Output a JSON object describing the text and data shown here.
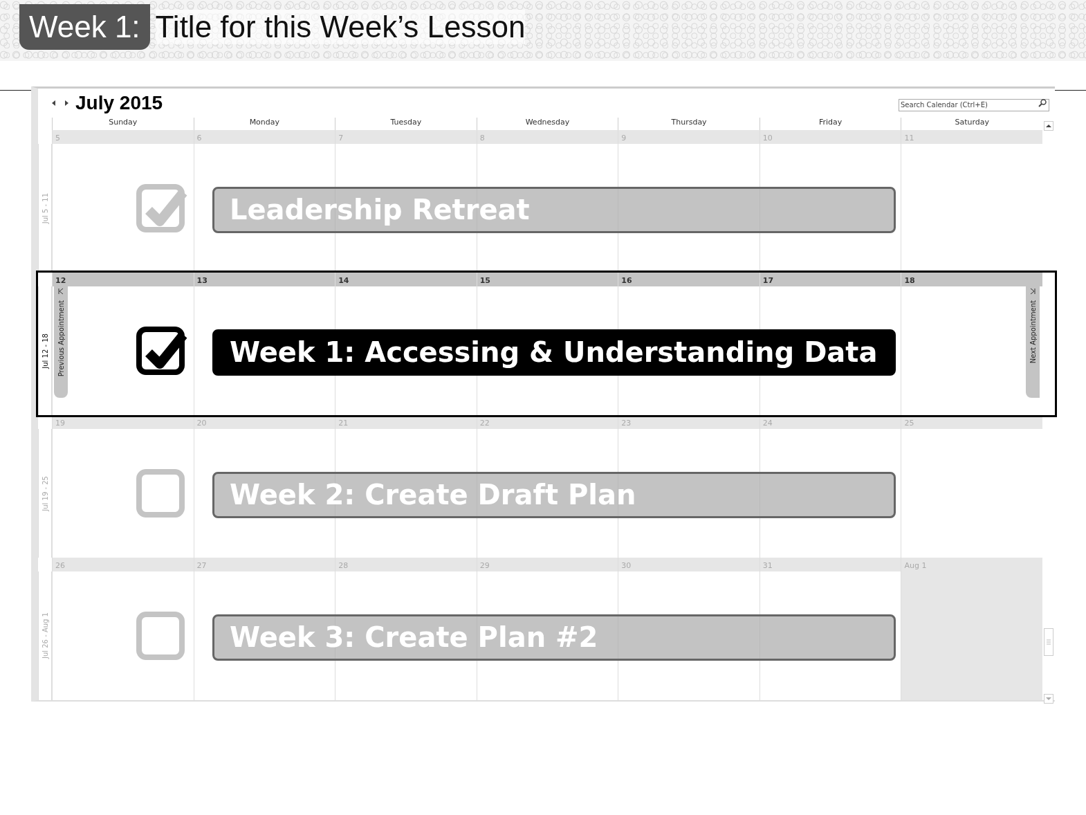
{
  "slide_header": {
    "badge": "Week 1:",
    "title": "Title for this Week’s Lesson"
  },
  "calendar": {
    "month_title": "July 2015",
    "search": {
      "placeholder": "Search Calendar (Ctrl+E)"
    },
    "day_names": [
      "Sunday",
      "Monday",
      "Tuesday",
      "Wednesday",
      "Thursday",
      "Friday",
      "Saturday"
    ],
    "weeks": [
      {
        "range": "Jul 5 - 11",
        "selected": false,
        "days": [
          {
            "date": "5",
            "outside_month": false
          },
          {
            "date": "6",
            "outside_month": false
          },
          {
            "date": "7",
            "outside_month": false
          },
          {
            "date": "8",
            "outside_month": false
          },
          {
            "date": "9",
            "outside_month": false
          },
          {
            "date": "10",
            "outside_month": false
          },
          {
            "date": "11",
            "outside_month": false
          }
        ],
        "task": {
          "title": "Leadership Retreat",
          "checked": true
        }
      },
      {
        "range": "Jul 12 - 18",
        "selected": true,
        "previous_tab": "Previous Appointment",
        "next_tab": "Next Appointment",
        "days": [
          {
            "date": "12",
            "outside_month": false
          },
          {
            "date": "13",
            "outside_month": false
          },
          {
            "date": "14",
            "outside_month": false
          },
          {
            "date": "15",
            "outside_month": false
          },
          {
            "date": "16",
            "outside_month": false
          },
          {
            "date": "17",
            "outside_month": false
          },
          {
            "date": "18",
            "outside_month": false
          }
        ],
        "task": {
          "title": "Week 1: Accessing & Understanding Data",
          "checked": true
        }
      },
      {
        "range": "Jul 19 - 25",
        "selected": false,
        "days": [
          {
            "date": "19",
            "outside_month": false
          },
          {
            "date": "20",
            "outside_month": false
          },
          {
            "date": "21",
            "outside_month": false
          },
          {
            "date": "22",
            "outside_month": false
          },
          {
            "date": "23",
            "outside_month": false
          },
          {
            "date": "24",
            "outside_month": false
          },
          {
            "date": "25",
            "outside_month": false
          }
        ],
        "task": {
          "title": "Week 2: Create Draft Plan",
          "checked": false
        }
      },
      {
        "range": "Jul 26 - Aug 1",
        "selected": false,
        "days": [
          {
            "date": "26",
            "outside_month": false
          },
          {
            "date": "27",
            "outside_month": false
          },
          {
            "date": "28",
            "outside_month": false
          },
          {
            "date": "29",
            "outside_month": false
          },
          {
            "date": "30",
            "outside_month": false
          },
          {
            "date": "31",
            "outside_month": false
          },
          {
            "date": "Aug 1",
            "outside_month": true
          }
        ],
        "task": {
          "title": "Week 3: Create Plan #2",
          "checked": false
        }
      }
    ]
  }
}
